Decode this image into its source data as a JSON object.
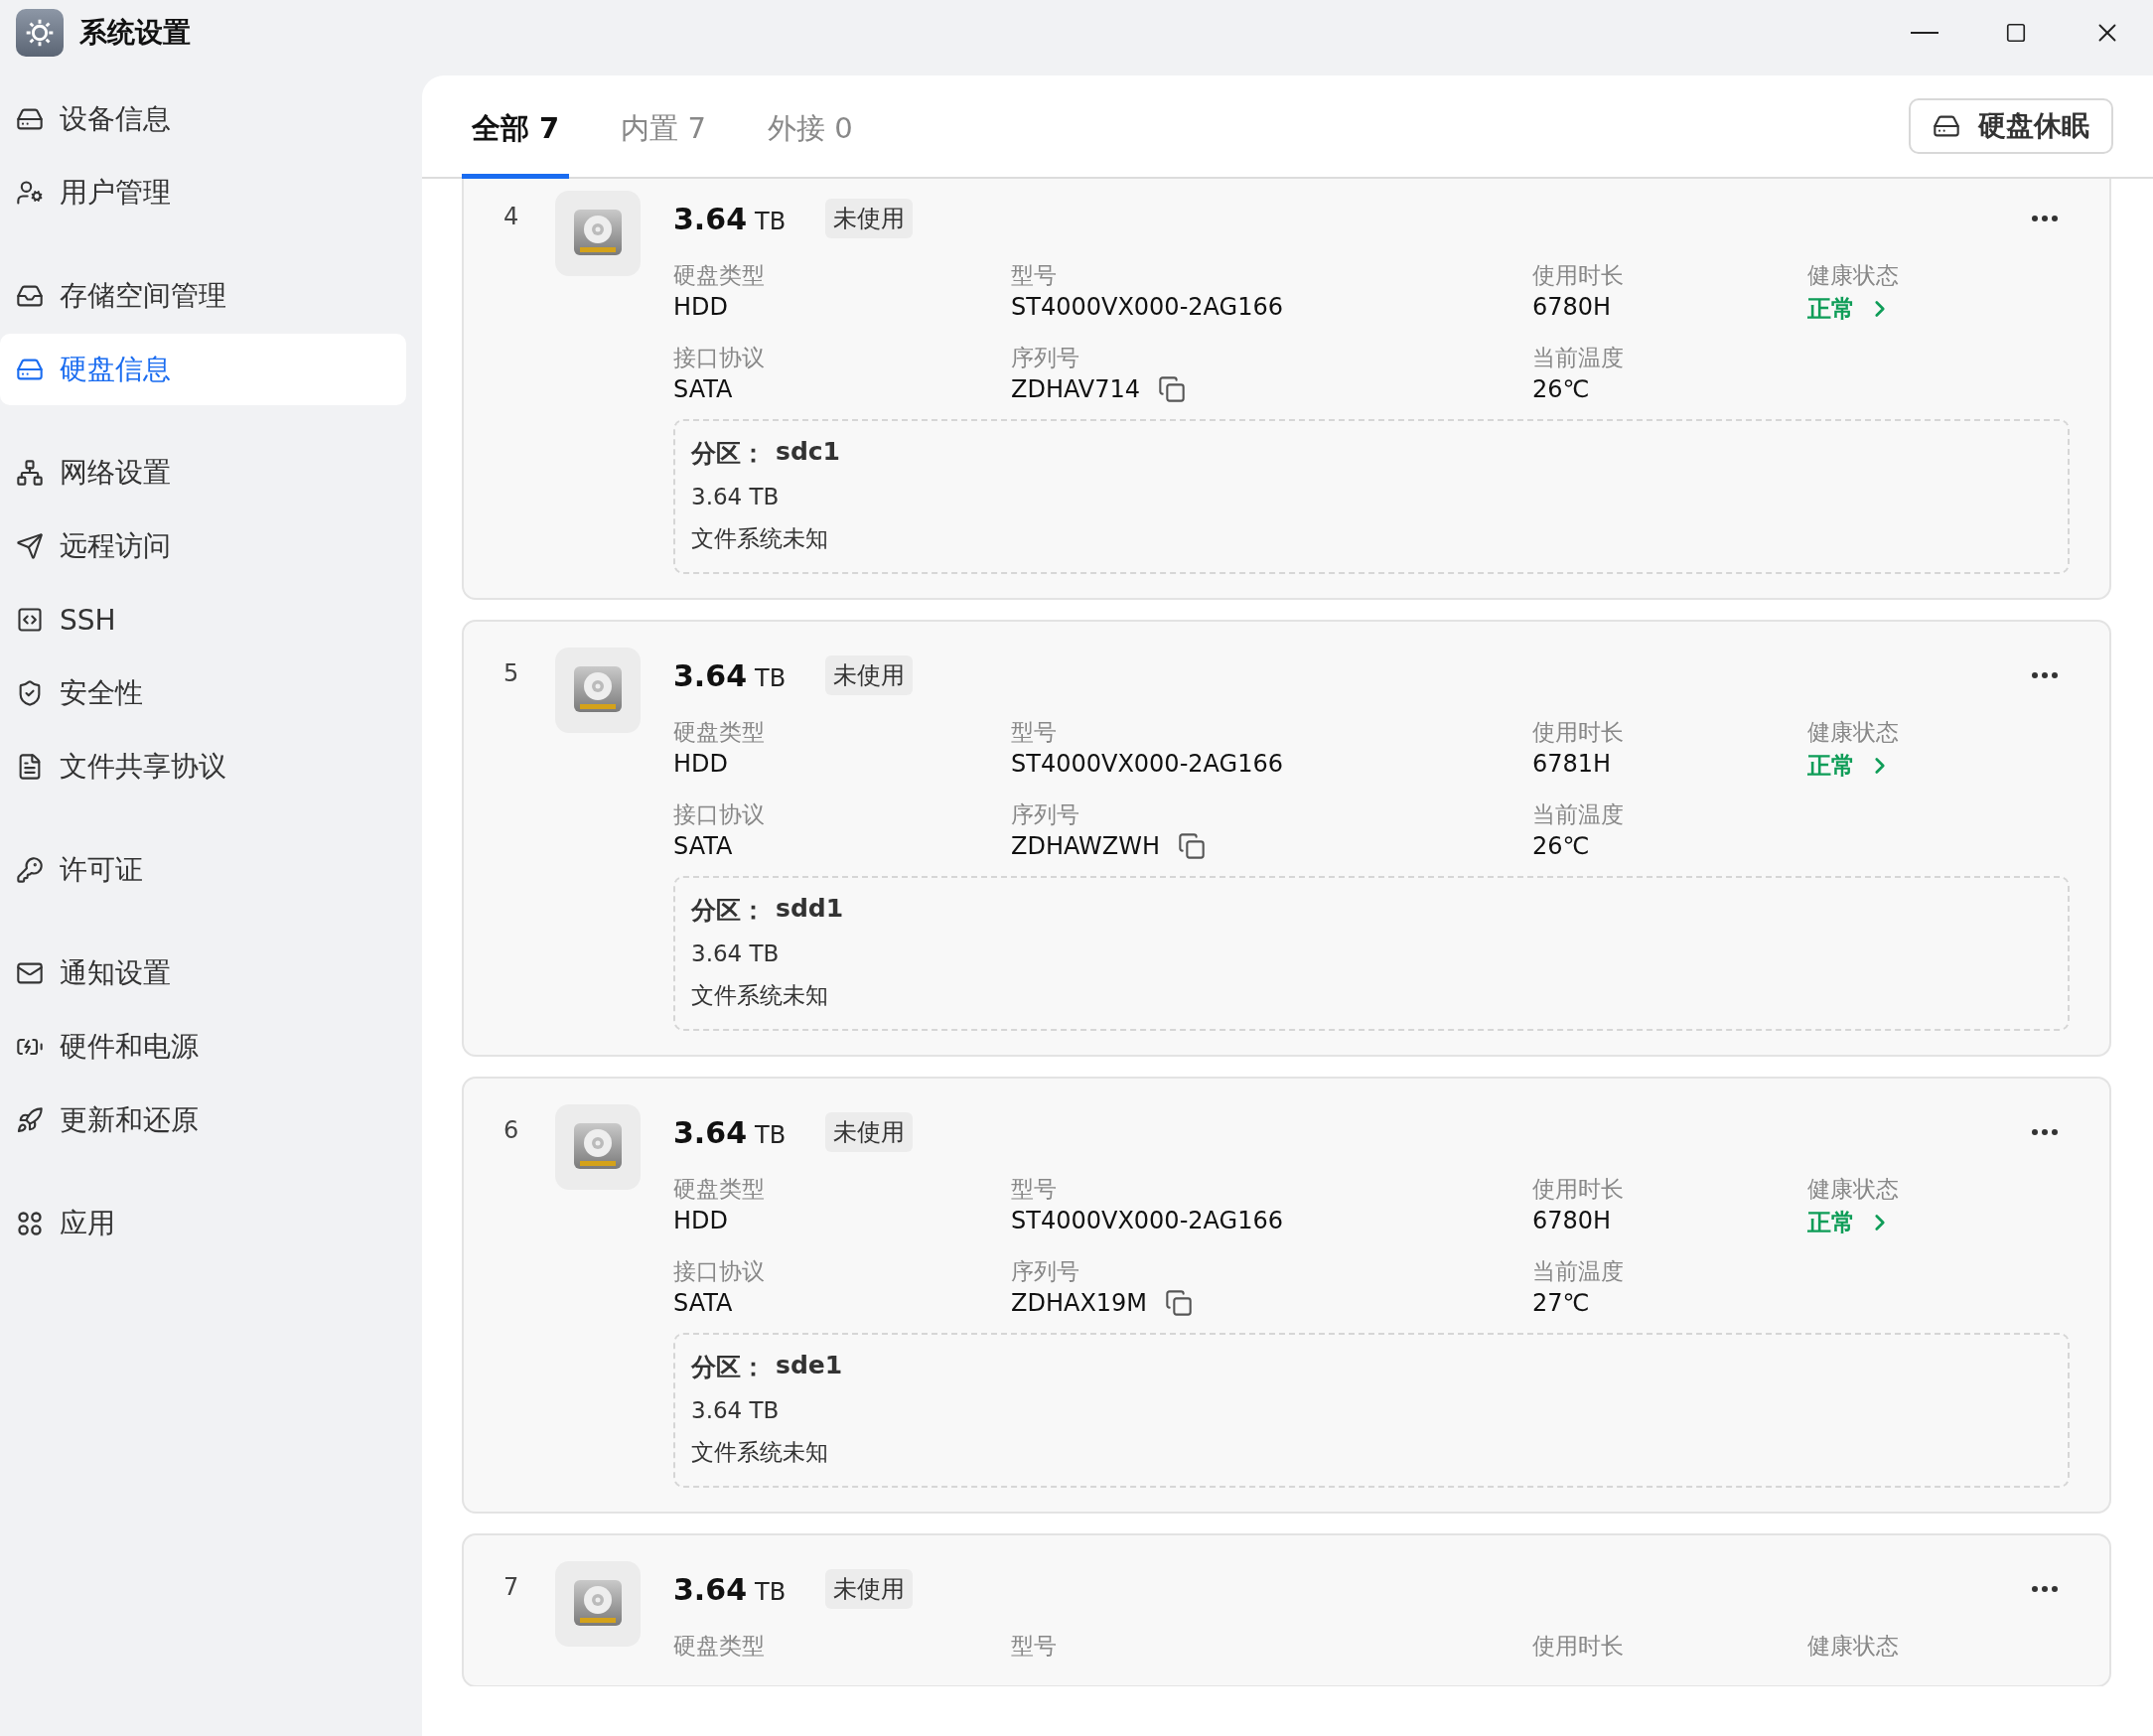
{
  "window": {
    "title": "系统设置"
  },
  "sidebar": {
    "groups": [
      {
        "items": [
          {
            "label": "设备信息",
            "selected": false
          },
          {
            "label": "用户管理",
            "selected": false
          }
        ]
      },
      {
        "items": [
          {
            "label": "存储空间管理",
            "selected": false
          },
          {
            "label": "硬盘信息",
            "selected": true
          }
        ]
      },
      {
        "items": [
          {
            "label": "网络设置",
            "selected": false
          },
          {
            "label": "远程访问",
            "selected": false
          },
          {
            "label": "SSH",
            "selected": false
          },
          {
            "label": "安全性",
            "selected": false
          },
          {
            "label": "文件共享协议",
            "selected": false
          }
        ]
      },
      {
        "items": [
          {
            "label": "许可证",
            "selected": false
          }
        ]
      },
      {
        "items": [
          {
            "label": "通知设置",
            "selected": false
          },
          {
            "label": "硬件和电源",
            "selected": false
          },
          {
            "label": "更新和还原",
            "selected": false
          }
        ]
      },
      {
        "items": [
          {
            "label": "应用",
            "selected": false
          }
        ]
      }
    ]
  },
  "tabs": [
    {
      "label": "全部 7",
      "selected": true
    },
    {
      "label": "内置 7",
      "selected": false
    },
    {
      "label": "外接 0",
      "selected": false
    }
  ],
  "sleep_button": "硬盘休眠",
  "disks": [
    {
      "index": "4",
      "size": "3.64",
      "unit": "TB",
      "status": "未使用",
      "fields": [
        {
          "kind": "text",
          "label": "硬盘类型",
          "value": "HDD"
        },
        {
          "kind": "text",
          "label": "型号",
          "value": "ST4000VX000-2AG166"
        },
        {
          "kind": "text",
          "label": "使用时长",
          "value": "6780H"
        },
        {
          "kind": "health",
          "label": "健康状态",
          "value": "正常"
        },
        {
          "kind": "text",
          "label": "接口协议",
          "value": "SATA"
        },
        {
          "kind": "copy",
          "label": "序列号",
          "value": "ZDHAV714"
        },
        {
          "kind": "text",
          "label": "当前温度",
          "value": "26℃"
        }
      ],
      "partition": {
        "label": "分区：",
        "name": "sdc1",
        "size": "3.64 TB",
        "filesystem": "文件系统未知"
      }
    },
    {
      "index": "5",
      "size": "3.64",
      "unit": "TB",
      "status": "未使用",
      "fields": [
        {
          "kind": "text",
          "label": "硬盘类型",
          "value": "HDD"
        },
        {
          "kind": "text",
          "label": "型号",
          "value": "ST4000VX000-2AG166"
        },
        {
          "kind": "text",
          "label": "使用时长",
          "value": "6781H"
        },
        {
          "kind": "health",
          "label": "健康状态",
          "value": "正常"
        },
        {
          "kind": "text",
          "label": "接口协议",
          "value": "SATA"
        },
        {
          "kind": "copy",
          "label": "序列号",
          "value": "ZDHAWZWH"
        },
        {
          "kind": "text",
          "label": "当前温度",
          "value": "26℃"
        }
      ],
      "partition": {
        "label": "分区：",
        "name": "sdd1",
        "size": "3.64 TB",
        "filesystem": "文件系统未知"
      }
    },
    {
      "index": "6",
      "size": "3.64",
      "unit": "TB",
      "status": "未使用",
      "fields": [
        {
          "kind": "text",
          "label": "硬盘类型",
          "value": "HDD"
        },
        {
          "kind": "text",
          "label": "型号",
          "value": "ST4000VX000-2AG166"
        },
        {
          "kind": "text",
          "label": "使用时长",
          "value": "6780H"
        },
        {
          "kind": "health",
          "label": "健康状态",
          "value": "正常"
        },
        {
          "kind": "text",
          "label": "接口协议",
          "value": "SATA"
        },
        {
          "kind": "copy",
          "label": "序列号",
          "value": "ZDHAX19M"
        },
        {
          "kind": "text",
          "label": "当前温度",
          "value": "27℃"
        }
      ],
      "partition": {
        "label": "分区：",
        "name": "sde1",
        "size": "3.64 TB",
        "filesystem": "文件系统未知"
      }
    },
    {
      "index": "7",
      "size": "3.64",
      "unit": "TB",
      "status": "未使用",
      "fields": [
        {
          "kind": "text",
          "label": "硬盘类型"
        },
        {
          "kind": "text",
          "label": "型号"
        },
        {
          "kind": "text",
          "label": "使用时长"
        },
        {
          "kind": "health",
          "label": "健康状态"
        }
      ]
    }
  ]
}
